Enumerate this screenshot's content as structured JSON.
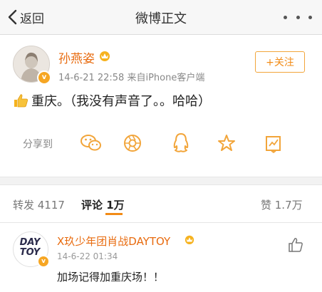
{
  "nav": {
    "back_label": "返回",
    "title": "微博正文"
  },
  "post": {
    "author": "孙燕姿",
    "meta": "14-6-21 22:58  来自iPhone客户端",
    "follow_label": "+关注",
    "text": "重庆。（我没有声音了。。哈哈）"
  },
  "share": {
    "label": "分享到",
    "icons": [
      "wechat-icon",
      "moments-icon",
      "qq-icon",
      "favorite-icon",
      "edit-icon"
    ]
  },
  "stats": {
    "reposts_label": "转发 4117",
    "comments_label": "评论 1万",
    "likes_label": "赞 1.7万"
  },
  "comment": {
    "author": "X玖少年团肖战DAYTOY",
    "time": "14-6-22 01:34",
    "text": "加场记得加重庆场！！",
    "avatar_text": "DAY TOY"
  },
  "colors": {
    "accent": "#f28b16",
    "name": "#e86b0f",
    "verified": "#f6a623"
  }
}
